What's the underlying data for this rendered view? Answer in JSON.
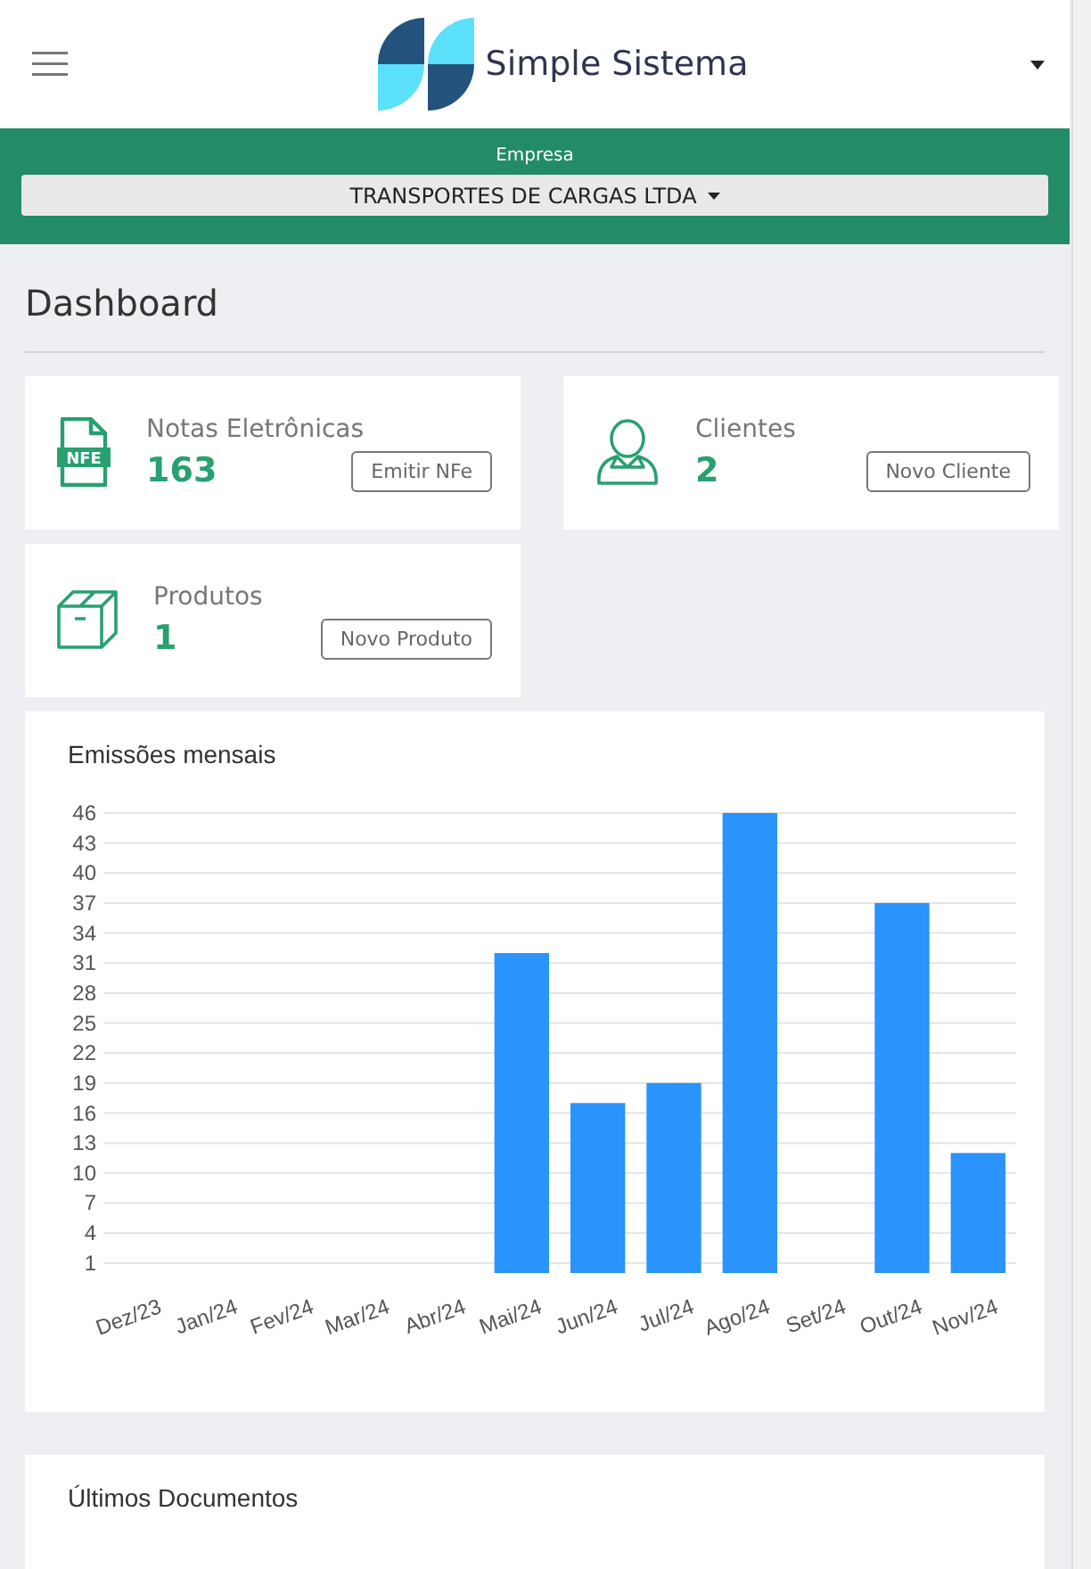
{
  "header": {
    "brand": "Simple Sistema"
  },
  "company": {
    "label": "Empresa",
    "value": "TRANSPORTES DE CARGAS LTDA"
  },
  "page_title": "Dashboard",
  "stat_cards": [
    {
      "kind": "nfe",
      "title": "Notas Eletrônicas",
      "count": "163",
      "button": "Emitir NFe",
      "icon_text": "NFE"
    },
    {
      "kind": "client",
      "title": "Clientes",
      "count": "2",
      "button": "Novo Cliente"
    },
    {
      "kind": "product",
      "title": "Produtos",
      "count": "1",
      "button": "Novo Produto"
    }
  ],
  "chart_card": {
    "title": "Emissões mensais",
    "chart_data": {
      "type": "bar",
      "categories": [
        "Dez/23",
        "Jan/24",
        "Fev/24",
        "Mar/24",
        "Abr/24",
        "Mai/24",
        "Jun/24",
        "Jul/24",
        "Ago/24",
        "Set/24",
        "Out/24",
        "Nov/24"
      ],
      "values": [
        0,
        0,
        0,
        0,
        0,
        32,
        17,
        19,
        46,
        0,
        37,
        12
      ],
      "grid": true,
      "ylim": [
        0,
        46
      ],
      "yticks": [
        1,
        4,
        7,
        10,
        13,
        16,
        19,
        22,
        25,
        28,
        31,
        34,
        37,
        40,
        43,
        46
      ]
    }
  },
  "documents_card": {
    "title": "Últimos Documentos"
  }
}
